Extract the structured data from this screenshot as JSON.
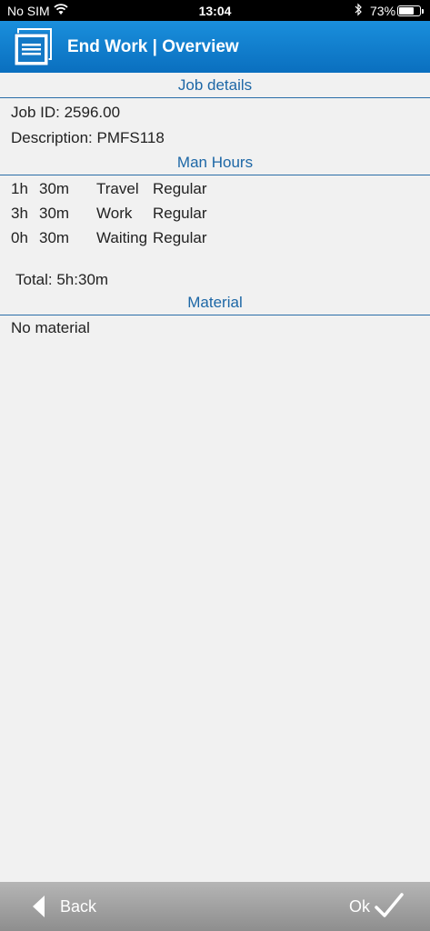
{
  "status_bar": {
    "carrier": "No SIM",
    "time": "13:04",
    "battery_percent": "73%",
    "battery_level": 0.73
  },
  "header": {
    "title": "End Work | Overview",
    "icon": "document-stack-icon",
    "accent_color": "#0e7bcc"
  },
  "job_details": {
    "section_title": "Job details",
    "job_id": "Job ID: 2596.00",
    "description": "Description: PMFS118"
  },
  "man_hours": {
    "section_title": "Man Hours",
    "rows": [
      {
        "hours": "1h",
        "minutes": "30m",
        "type": "Travel",
        "rate": "Regular"
      },
      {
        "hours": "3h",
        "minutes": "30m",
        "type": "Work",
        "rate": "Regular"
      },
      {
        "hours": "0h",
        "minutes": "30m",
        "type": "Waiting",
        "rate": "Regular"
      }
    ],
    "total": "Total: 5h:30m"
  },
  "material": {
    "section_title": "Material",
    "empty_text": "No material"
  },
  "footer": {
    "back_label": "Back",
    "ok_label": "Ok"
  }
}
